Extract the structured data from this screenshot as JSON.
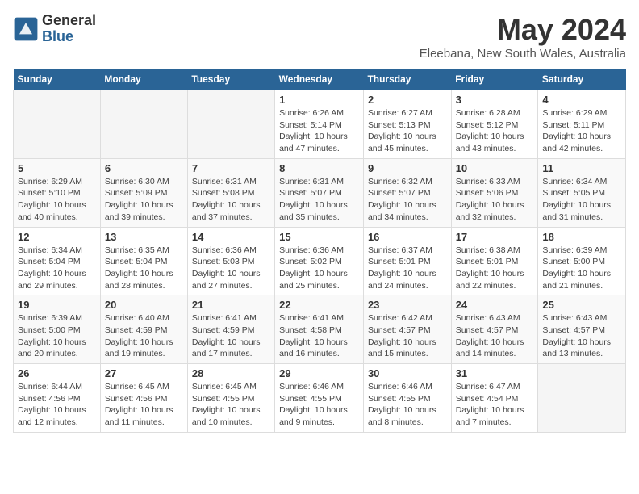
{
  "logo": {
    "general": "General",
    "blue": "Blue"
  },
  "title": "May 2024",
  "subtitle": "Eleebana, New South Wales, Australia",
  "days_header": [
    "Sunday",
    "Monday",
    "Tuesday",
    "Wednesday",
    "Thursday",
    "Friday",
    "Saturday"
  ],
  "weeks": [
    [
      {
        "day": "",
        "info": ""
      },
      {
        "day": "",
        "info": ""
      },
      {
        "day": "",
        "info": ""
      },
      {
        "day": "1",
        "info": "Sunrise: 6:26 AM\nSunset: 5:14 PM\nDaylight: 10 hours and 47 minutes."
      },
      {
        "day": "2",
        "info": "Sunrise: 6:27 AM\nSunset: 5:13 PM\nDaylight: 10 hours and 45 minutes."
      },
      {
        "day": "3",
        "info": "Sunrise: 6:28 AM\nSunset: 5:12 PM\nDaylight: 10 hours and 43 minutes."
      },
      {
        "day": "4",
        "info": "Sunrise: 6:29 AM\nSunset: 5:11 PM\nDaylight: 10 hours and 42 minutes."
      }
    ],
    [
      {
        "day": "5",
        "info": "Sunrise: 6:29 AM\nSunset: 5:10 PM\nDaylight: 10 hours and 40 minutes."
      },
      {
        "day": "6",
        "info": "Sunrise: 6:30 AM\nSunset: 5:09 PM\nDaylight: 10 hours and 39 minutes."
      },
      {
        "day": "7",
        "info": "Sunrise: 6:31 AM\nSunset: 5:08 PM\nDaylight: 10 hours and 37 minutes."
      },
      {
        "day": "8",
        "info": "Sunrise: 6:31 AM\nSunset: 5:07 PM\nDaylight: 10 hours and 35 minutes."
      },
      {
        "day": "9",
        "info": "Sunrise: 6:32 AM\nSunset: 5:07 PM\nDaylight: 10 hours and 34 minutes."
      },
      {
        "day": "10",
        "info": "Sunrise: 6:33 AM\nSunset: 5:06 PM\nDaylight: 10 hours and 32 minutes."
      },
      {
        "day": "11",
        "info": "Sunrise: 6:34 AM\nSunset: 5:05 PM\nDaylight: 10 hours and 31 minutes."
      }
    ],
    [
      {
        "day": "12",
        "info": "Sunrise: 6:34 AM\nSunset: 5:04 PM\nDaylight: 10 hours and 29 minutes."
      },
      {
        "day": "13",
        "info": "Sunrise: 6:35 AM\nSunset: 5:04 PM\nDaylight: 10 hours and 28 minutes."
      },
      {
        "day": "14",
        "info": "Sunrise: 6:36 AM\nSunset: 5:03 PM\nDaylight: 10 hours and 27 minutes."
      },
      {
        "day": "15",
        "info": "Sunrise: 6:36 AM\nSunset: 5:02 PM\nDaylight: 10 hours and 25 minutes."
      },
      {
        "day": "16",
        "info": "Sunrise: 6:37 AM\nSunset: 5:01 PM\nDaylight: 10 hours and 24 minutes."
      },
      {
        "day": "17",
        "info": "Sunrise: 6:38 AM\nSunset: 5:01 PM\nDaylight: 10 hours and 22 minutes."
      },
      {
        "day": "18",
        "info": "Sunrise: 6:39 AM\nSunset: 5:00 PM\nDaylight: 10 hours and 21 minutes."
      }
    ],
    [
      {
        "day": "19",
        "info": "Sunrise: 6:39 AM\nSunset: 5:00 PM\nDaylight: 10 hours and 20 minutes."
      },
      {
        "day": "20",
        "info": "Sunrise: 6:40 AM\nSunset: 4:59 PM\nDaylight: 10 hours and 19 minutes."
      },
      {
        "day": "21",
        "info": "Sunrise: 6:41 AM\nSunset: 4:59 PM\nDaylight: 10 hours and 17 minutes."
      },
      {
        "day": "22",
        "info": "Sunrise: 6:41 AM\nSunset: 4:58 PM\nDaylight: 10 hours and 16 minutes."
      },
      {
        "day": "23",
        "info": "Sunrise: 6:42 AM\nSunset: 4:57 PM\nDaylight: 10 hours and 15 minutes."
      },
      {
        "day": "24",
        "info": "Sunrise: 6:43 AM\nSunset: 4:57 PM\nDaylight: 10 hours and 14 minutes."
      },
      {
        "day": "25",
        "info": "Sunrise: 6:43 AM\nSunset: 4:57 PM\nDaylight: 10 hours and 13 minutes."
      }
    ],
    [
      {
        "day": "26",
        "info": "Sunrise: 6:44 AM\nSunset: 4:56 PM\nDaylight: 10 hours and 12 minutes."
      },
      {
        "day": "27",
        "info": "Sunrise: 6:45 AM\nSunset: 4:56 PM\nDaylight: 10 hours and 11 minutes."
      },
      {
        "day": "28",
        "info": "Sunrise: 6:45 AM\nSunset: 4:55 PM\nDaylight: 10 hours and 10 minutes."
      },
      {
        "day": "29",
        "info": "Sunrise: 6:46 AM\nSunset: 4:55 PM\nDaylight: 10 hours and 9 minutes."
      },
      {
        "day": "30",
        "info": "Sunrise: 6:46 AM\nSunset: 4:55 PM\nDaylight: 10 hours and 8 minutes."
      },
      {
        "day": "31",
        "info": "Sunrise: 6:47 AM\nSunset: 4:54 PM\nDaylight: 10 hours and 7 minutes."
      },
      {
        "day": "",
        "info": ""
      }
    ]
  ]
}
